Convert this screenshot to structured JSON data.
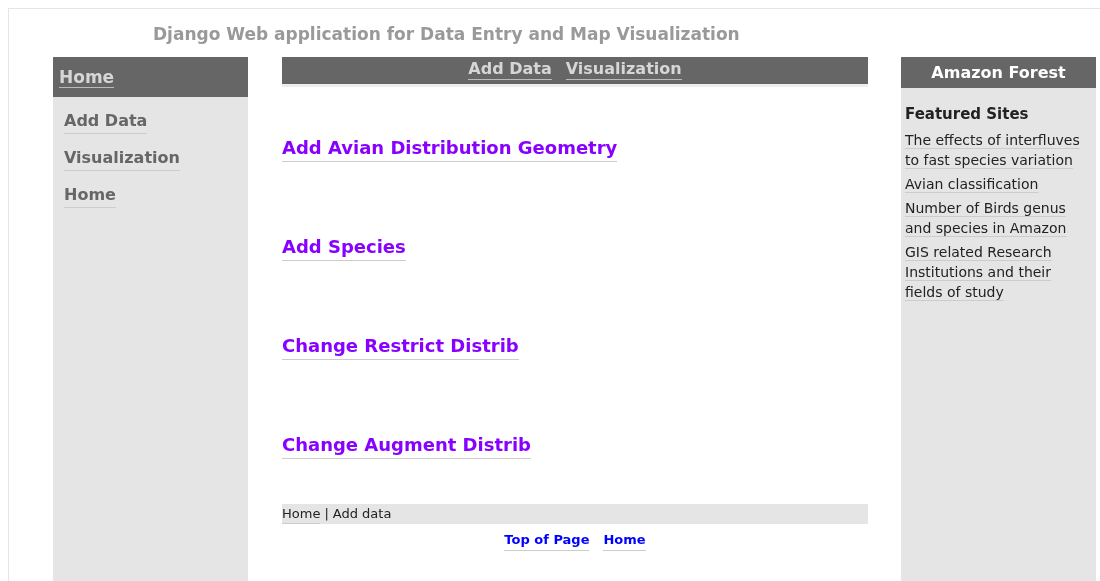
{
  "title": "Django Web application for Data Entry and Map Visualization",
  "sidebar": {
    "header": "Home",
    "items": [
      "Add Data",
      "Visualization",
      "Home"
    ]
  },
  "top_nav": [
    "Add Data",
    "Visualization"
  ],
  "actions": [
    "Add Avian Distribution Geometry",
    "Add Species",
    "Change Restrict Distrib",
    "Change Augment Distrib"
  ],
  "breadcrumb": {
    "link": "Home",
    "separator": "|",
    "current": "Add data"
  },
  "footer_links": [
    "Top of Page",
    "Home"
  ],
  "right_panel": {
    "header": "Amazon Forest",
    "heading": "Featured Sites",
    "links": [
      "The effects of interfluves to fast species variation",
      "Avian classification",
      "Number of Birds genus and species in Amazon",
      "GIS related Research Institutions and their fields of study"
    ]
  }
}
